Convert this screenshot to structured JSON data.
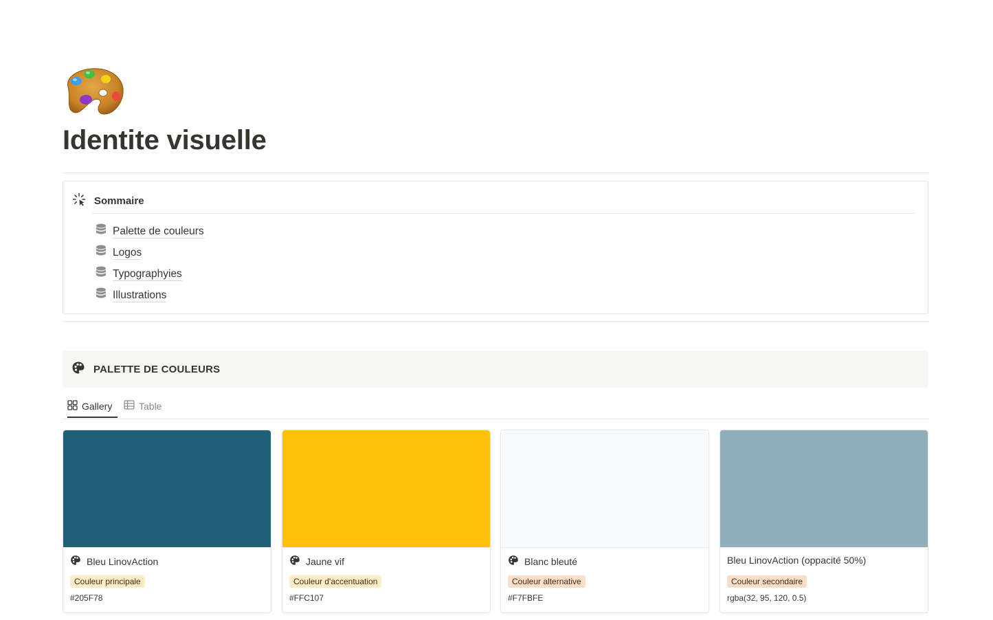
{
  "page": {
    "icon": "artist-palette-icon",
    "title": "Identite visuelle"
  },
  "summary": {
    "icon": "loading-sparkle-icon",
    "label": "Sommaire",
    "items": [
      {
        "label": "Palette de couleurs",
        "icon": "database-icon"
      },
      {
        "label": "Logos",
        "icon": "database-icon"
      },
      {
        "label": "Typographyies",
        "icon": "database-icon"
      },
      {
        "label": "Illustrations",
        "icon": "database-icon"
      }
    ]
  },
  "palette_section": {
    "icon": "palette-icon",
    "label": "PALETTE DE COULEURS",
    "tabs": [
      {
        "label": "Gallery",
        "icon": "gallery-grid-icon",
        "active": true
      },
      {
        "label": "Table",
        "icon": "table-icon",
        "active": false
      }
    ],
    "cards": [
      {
        "name": "Bleu LinovAction",
        "icon": "palette-icon",
        "tag": "Couleur principale",
        "tag_color": "#fdecc8",
        "value": "#205F78",
        "swatch": "#205F78"
      },
      {
        "name": "Jaune vif",
        "icon": "palette-icon",
        "tag": "Couleur d'accentuation",
        "tag_color": "#fdecc8",
        "value": "#FFC107",
        "swatch": "#FFC107"
      },
      {
        "name": "Blanc bleuté",
        "icon": "palette-icon",
        "tag": "Couleur alternative",
        "tag_color": "#fadec9",
        "value": "#F7FBFE",
        "swatch": "#F7FBFE"
      },
      {
        "name": "Bleu LinovAction (oppacité 50%)",
        "icon": "",
        "tag": "Couleur secondaire",
        "tag_color": "#fadec9",
        "value": "rgba(32, 95, 120, 0.5)",
        "swatch": "rgba(32, 95, 120, 0.5)"
      }
    ]
  }
}
